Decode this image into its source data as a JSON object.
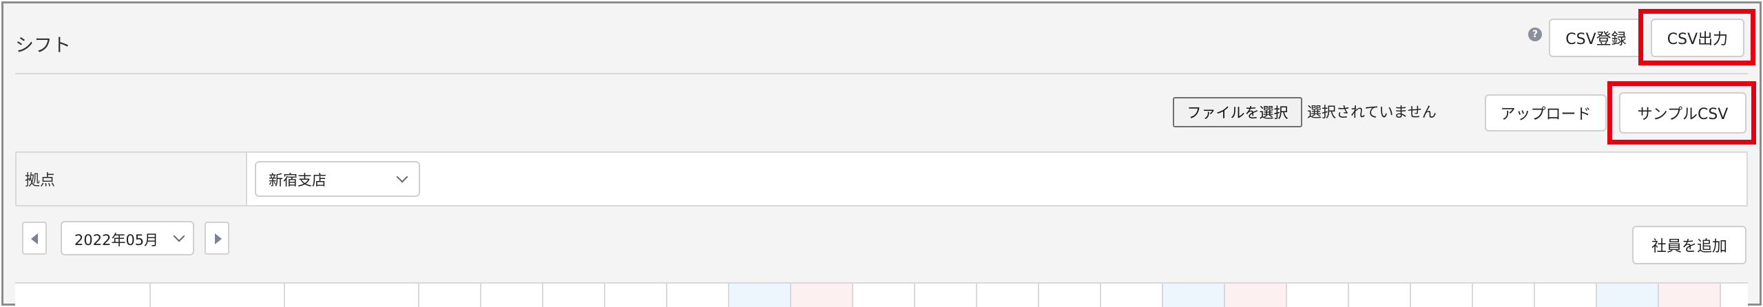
{
  "header": {
    "title": "シフト",
    "help_icon": "?",
    "csv_register_label": "CSV登録",
    "csv_export_label": "CSV出力"
  },
  "upload": {
    "choose_file_label": "ファイルを選択",
    "file_status": "選択されていません",
    "upload_label": "アップロード",
    "sample_csv_label": "サンプルCSV"
  },
  "filter": {
    "label": "拠点",
    "branch_value": "新宿支店"
  },
  "month_nav": {
    "month_value": "2022年05月"
  },
  "actions": {
    "add_employee_label": "社員を追加"
  },
  "colors": {
    "highlight": "#e60012",
    "background": "#f4f4f5",
    "weekend_blue": "#eef6fd",
    "weekend_red": "#fdf0f1"
  }
}
